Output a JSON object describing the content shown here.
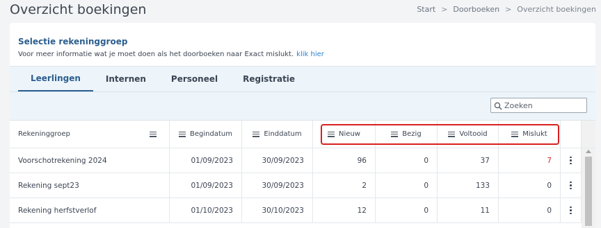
{
  "page": {
    "title": "Overzicht boekingen",
    "breadcrumb": [
      "Start",
      "Doorboeken",
      "Overzicht boekingen"
    ]
  },
  "selection": {
    "title": "Selectie rekeninggroep",
    "info": "Voor meer informatie wat je moet doen als het doorboeken naar Exact mislukt.",
    "link": "klik hier"
  },
  "tabs": [
    {
      "label": "Leerlingen",
      "active": true
    },
    {
      "label": "Internen",
      "active": false
    },
    {
      "label": "Personeel",
      "active": false
    },
    {
      "label": "Registratie",
      "active": false
    }
  ],
  "search": {
    "placeholder": "Zoeken",
    "icon": "search-icon"
  },
  "table": {
    "columns": [
      "Rekeninggroep",
      "Begindatum",
      "Einddatum",
      "Nieuw",
      "Bezig",
      "Voltooid",
      "Mislukt"
    ],
    "rows": [
      [
        "Voorschotrekening 2024",
        "01/09/2023",
        "30/09/2023",
        "96",
        "0",
        "37",
        "7"
      ],
      [
        "Rekening sept23",
        "01/09/2023",
        "30/09/2023",
        "2",
        "0",
        "133",
        "0"
      ],
      [
        "Rekening herfstverlof",
        "01/10/2023",
        "30/10/2023",
        "12",
        "0",
        "11",
        "0"
      ]
    ]
  },
  "colors": {
    "accent": "#2c5e8f",
    "link": "#2a7fd0",
    "failed": "#d12b2b",
    "highlight": "#d81f1f"
  }
}
